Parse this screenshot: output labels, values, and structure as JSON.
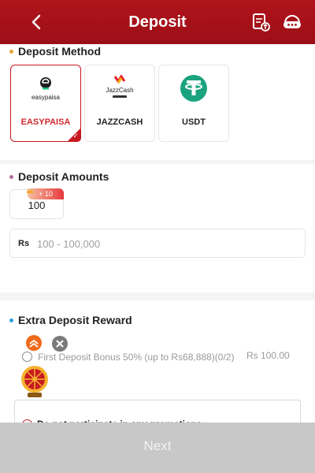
{
  "header": {
    "title": "Deposit"
  },
  "deposit_method": {
    "title": "Deposit Method",
    "methods": [
      {
        "label": "EASYPAISA",
        "logo_text": "easypaisa",
        "selected": true
      },
      {
        "label": "JAZZCASH",
        "logo_text": "JazzCash"
      },
      {
        "label": "USDT"
      }
    ]
  },
  "deposit_amounts": {
    "title": "Deposit Amounts",
    "chips": [
      {
        "value": "100",
        "bonus": "+ 10"
      }
    ],
    "currency": "Rs",
    "placeholder": "100 - 100,000"
  },
  "extra_reward": {
    "title": "Extra Deposit Reward",
    "options": [
      {
        "label": "First Deposit Bonus 50% (up to Rs68,888)(0/2)",
        "amount": "Rs 100.00"
      },
      {
        "label": "Do not participate in any promotions",
        "selected": true
      }
    ]
  },
  "footer": {
    "next_label": "Next"
  },
  "colors": {
    "brand": "#b0131b",
    "accent_red": "#d12930",
    "teal": "#1aa37e",
    "footer": "#c8c8c8"
  }
}
